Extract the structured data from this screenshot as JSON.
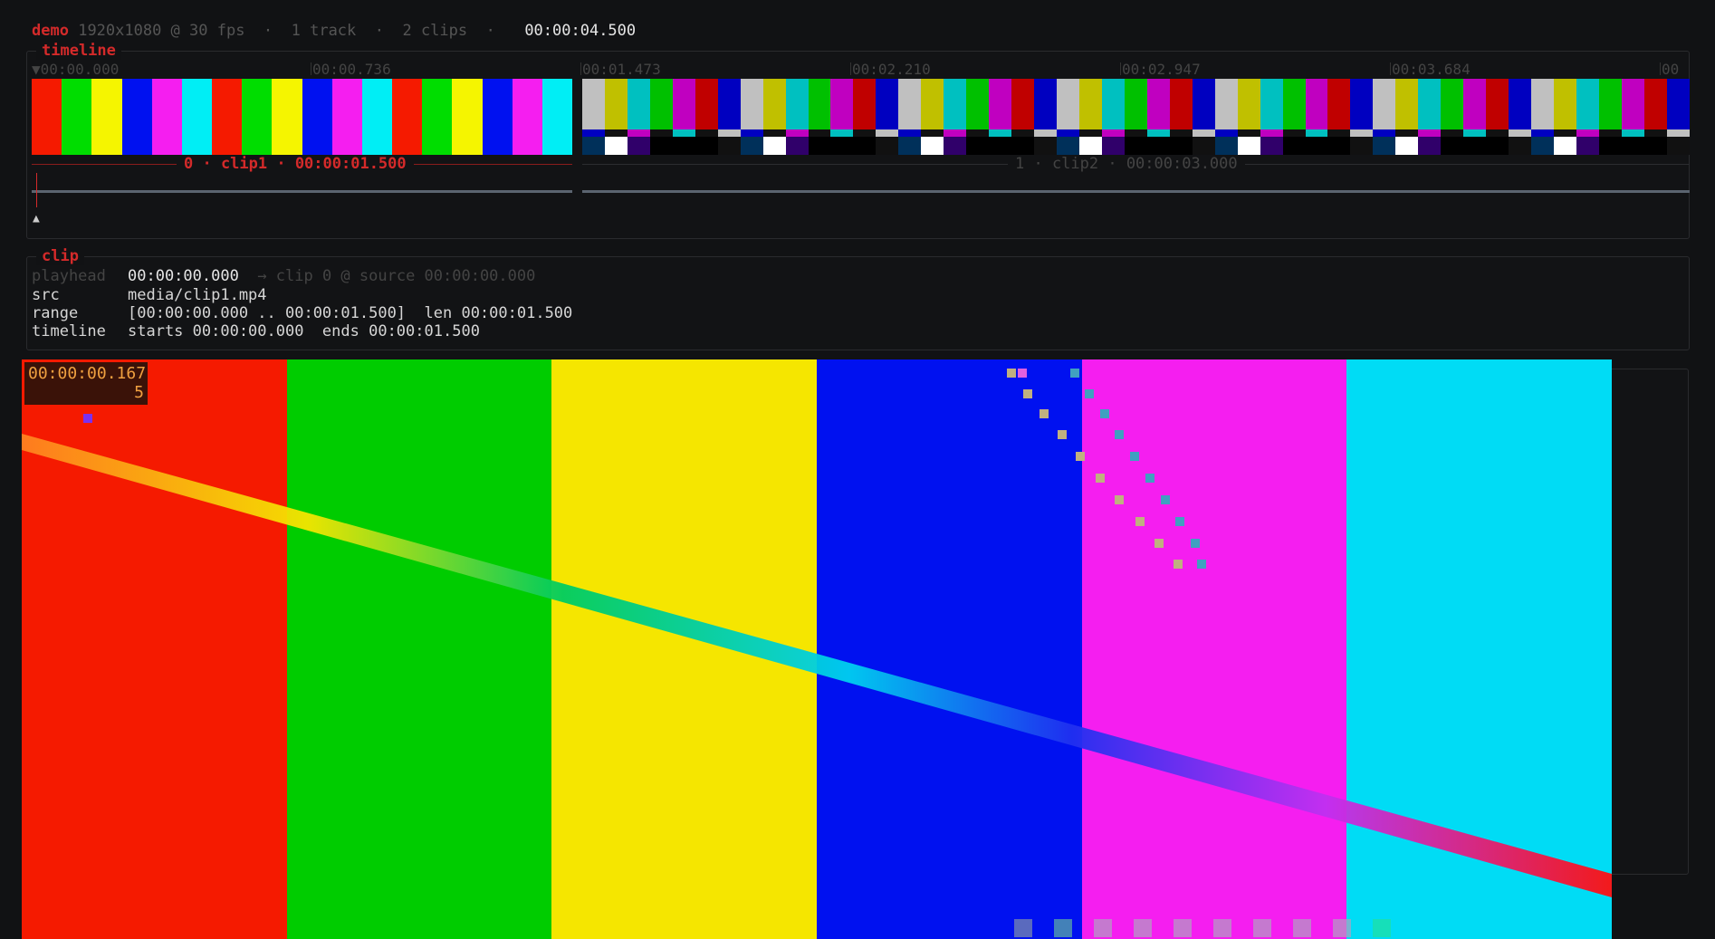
{
  "header": {
    "project": "demo",
    "format": "1920x1080 @ 30 fps",
    "tracks": "1 track",
    "clips": "2 clips",
    "time": "00:00:04.500"
  },
  "timeline": {
    "title": "timeline",
    "ruler": [
      "▼00:00.000",
      "00:00.736",
      "00:01.473",
      "00:02.210",
      "00:02.947",
      "00:03.684",
      "00"
    ],
    "clip1_label": "0 · clip1 · 00:00:01.500",
    "clip2_label": "1 · clip2 · 00:00:03.000"
  },
  "clip": {
    "title": "clip",
    "rows": [
      {
        "key": "playhead",
        "value": "00:00:00.000",
        "extra": "→ clip 0 @ source 00:00:00.000"
      },
      {
        "key": "src",
        "value": "media/clip1.mp4",
        "extra": ""
      },
      {
        "key": "range",
        "value": "[00:00:00.000 .. 00:00:01.500]  len 00:00:01.500",
        "extra": ""
      },
      {
        "key": "timeline",
        "value": "starts 00:00:00.000  ends 00:00:01.500",
        "extra": ""
      }
    ]
  },
  "viewer": {
    "timecode": "00:00:00.167",
    "frame": "5",
    "colors": [
      "#f51a00",
      "#00cc00",
      "#f5e600",
      "#0011f0",
      "#f51ef0",
      "#00dcf5"
    ]
  },
  "colors": {
    "accent": "#d42a2a",
    "clip1_strip": [
      "#f51a00",
      "#00dd00",
      "#f5f500",
      "#0011f0",
      "#f51ef0",
      "#00eef5",
      "#f51a00",
      "#00dd00",
      "#f5f500",
      "#0011f0",
      "#f51ef0",
      "#00eef5",
      "#f51a00",
      "#00dd00",
      "#f5f500",
      "#0011f0",
      "#f51ef0",
      "#00eef5"
    ],
    "clip2_strip": [
      "#c0c0c0",
      "#c0c000",
      "#00c0c0",
      "#00c000",
      "#c000c0",
      "#c00000",
      "#0000c0"
    ]
  }
}
